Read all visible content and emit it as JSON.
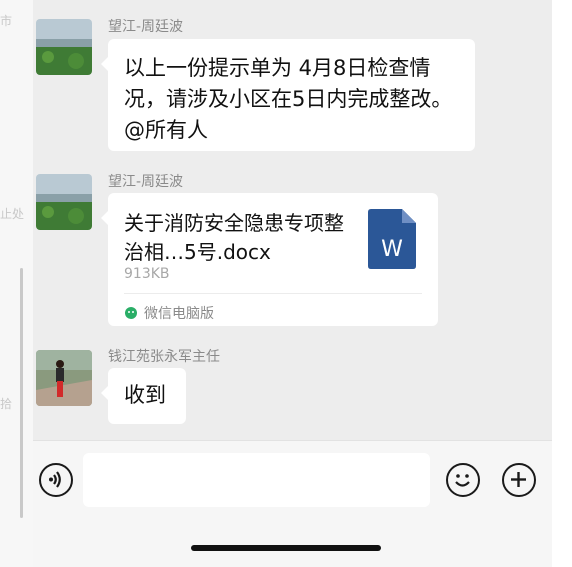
{
  "background_side_text": [
    "市",
    "止处",
    "拾"
  ],
  "messages": [
    {
      "sender": "望江-周廷波",
      "type": "text",
      "text": "以上一份提示单为 4月8日检查情况，请涉及小区在5日内完成整改。@所有人"
    },
    {
      "sender": "望江-周廷波",
      "type": "file",
      "file_name": "关于消防安全隐患专项整治相…5号.docx",
      "file_size": "913KB",
      "file_icon_letter": "W",
      "source": "微信电脑版"
    },
    {
      "sender": "钱江苑张永军主任",
      "type": "text",
      "text": "收到"
    }
  ],
  "input_bar": {
    "voice_icon": "voice-icon",
    "emoji_icon": "emoji-icon",
    "plus_icon": "plus-icon",
    "input_value": ""
  },
  "colors": {
    "chat_background": "#ededed",
    "bubble": "#ffffff",
    "word_icon_blue": "#2b5797",
    "wechat_green": "#2aae67"
  }
}
